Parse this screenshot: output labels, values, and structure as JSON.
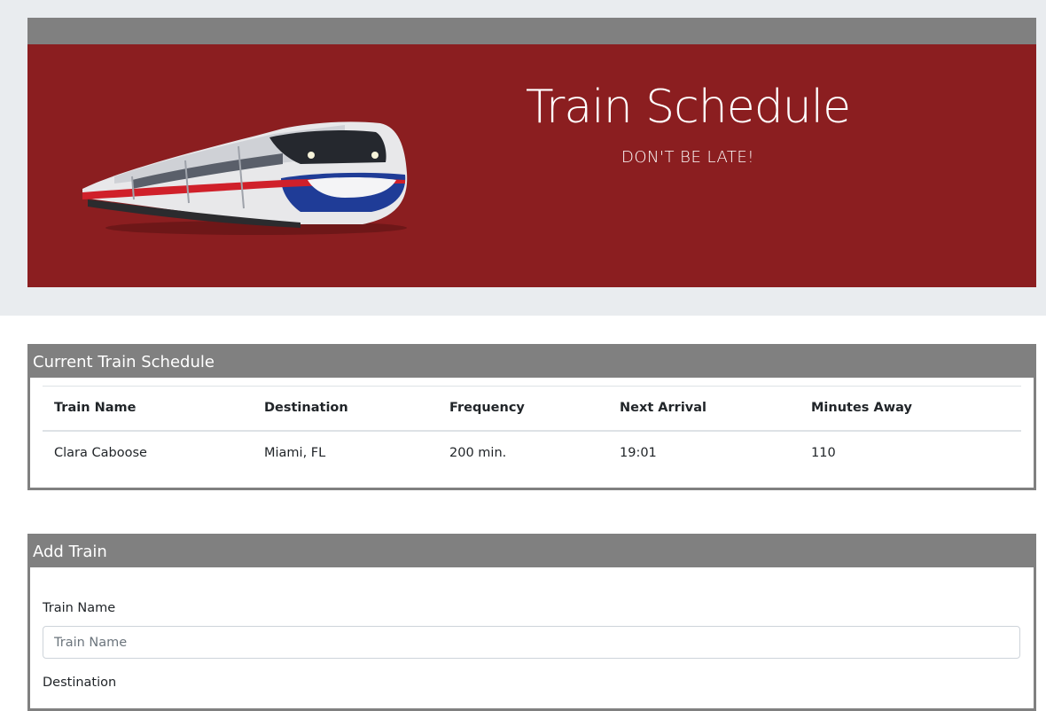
{
  "header": {
    "title": "Train Schedule",
    "subtitle": "DON'T BE LATE!",
    "banner_color": "#8b1e20",
    "bar_color": "#808080",
    "image": "train-image"
  },
  "schedule": {
    "heading": "Current Train Schedule",
    "columns": [
      "Train Name",
      "Destination",
      "Frequency",
      "Next Arrival",
      "Minutes Away"
    ],
    "rows": [
      [
        "Clara Caboose",
        "Miami, FL",
        "200 min.",
        "19:01",
        "110"
      ]
    ]
  },
  "add_train": {
    "heading": "Add Train",
    "name_label": "Train Name",
    "name_placeholder": "Train Name",
    "destination_label": "Destination"
  }
}
